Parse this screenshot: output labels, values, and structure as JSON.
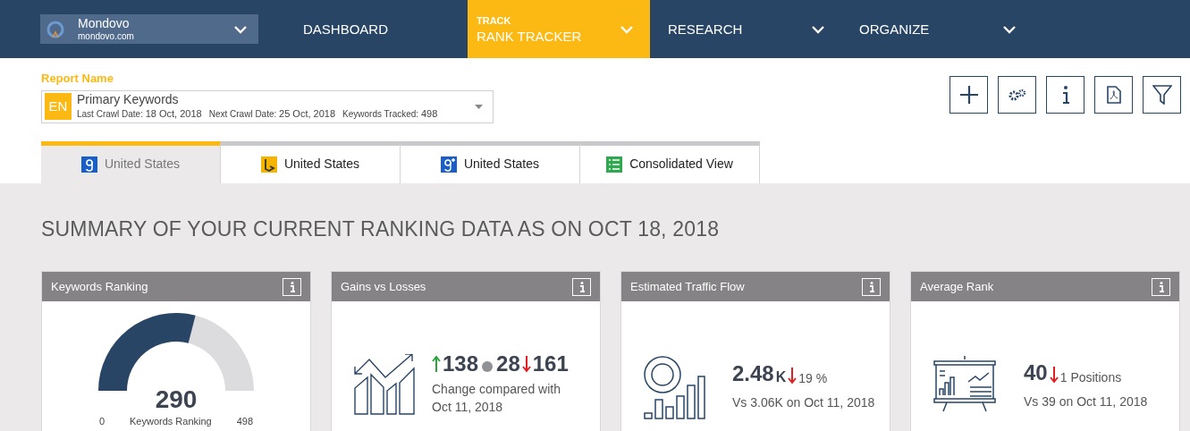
{
  "nav": {
    "brand": {
      "name": "Mondovo",
      "domain": "mondovo.com"
    },
    "items": [
      {
        "label": "DASHBOARD",
        "selected": false,
        "dropdown": false
      },
      {
        "label": "RANK TRACKER",
        "kicker": "TRACK",
        "selected": true,
        "dropdown": true
      },
      {
        "label": "RESEARCH",
        "selected": false,
        "dropdown": true
      },
      {
        "label": "ORGANIZE",
        "selected": false,
        "dropdown": true
      }
    ]
  },
  "report": {
    "label": "Report Name",
    "badge": "EN",
    "name": "Primary Keywords",
    "meta": [
      {
        "label": "Last Crawl Date:",
        "value": "18 Oct, 2018"
      },
      {
        "label": "Next Crawl Date:",
        "value": "25 Oct, 2018"
      },
      {
        "label": "Keywords Tracked:",
        "value": "498"
      }
    ]
  },
  "toolbar": [
    {
      "kind": "add"
    },
    {
      "kind": "settings"
    },
    {
      "kind": "info"
    },
    {
      "kind": "pdf"
    },
    {
      "kind": "filter"
    }
  ],
  "tabs": [
    {
      "label": "United States",
      "kind": "google",
      "selected": true
    },
    {
      "label": "United States",
      "kind": "bing",
      "selected": false
    },
    {
      "label": "United States",
      "kind": "googleplus",
      "selected": false
    },
    {
      "label": "Consolidated View",
      "kind": "consolidated",
      "selected": false
    }
  ],
  "summary_title": "SUMMARY OF YOUR CURRENT RANKING DATA AS ON OCT 18, 2018",
  "cards": [
    {
      "kind": "gauge",
      "title": "Keywords Ranking",
      "value": "290",
      "level": 0.58,
      "min": "0",
      "max": "498",
      "caption": "Keywords Ranking"
    },
    {
      "kind": "gains",
      "title": "Gains vs Losses",
      "gains": "138",
      "neutral": "28",
      "losses": "161",
      "caption": "Change compared with Oct 11, 2018"
    },
    {
      "kind": "traffic",
      "title": "Estimated Traffic Flow",
      "value": "2.48",
      "unit": "K",
      "decreased": true,
      "change": "19 %",
      "caption": "Vs 3.06K on Oct 11, 2018"
    },
    {
      "kind": "rank",
      "title": "Average Rank",
      "value": "40",
      "decreased": true,
      "change": "1 Positions",
      "caption": "Vs 39 on Oct 11, 2018"
    }
  ]
}
